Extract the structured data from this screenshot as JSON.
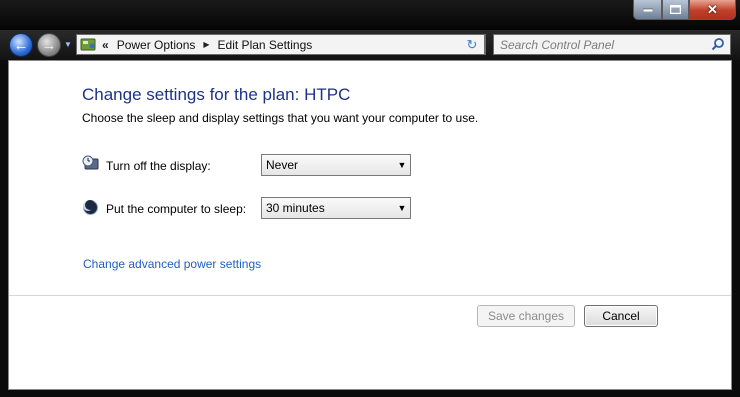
{
  "titlebar": {
    "minimize_label": "minimize",
    "maximize_label": "maximize",
    "close_label": "close"
  },
  "navigation": {
    "breadcrumb_chevron": "«",
    "breadcrumbs": [
      "Power Options",
      "Edit Plan Settings"
    ],
    "search_placeholder": "Search Control Panel"
  },
  "main": {
    "heading": "Change settings for the plan: HTPC",
    "subtext": "Choose the sleep and display settings that you want your computer to use.",
    "settings": [
      {
        "label": "Turn off the display:",
        "value": "Never",
        "icon": "display-timer-icon"
      },
      {
        "label": "Put the computer to sleep:",
        "value": "30 minutes",
        "icon": "moon-sleep-icon"
      }
    ],
    "advanced_link": "Change advanced power settings"
  },
  "footer": {
    "save_label": "Save changes",
    "save_enabled": false,
    "cancel_label": "Cancel"
  },
  "colors": {
    "heading": "#1e3287",
    "link": "#1f5fbf",
    "close_button": "#c0402a"
  }
}
